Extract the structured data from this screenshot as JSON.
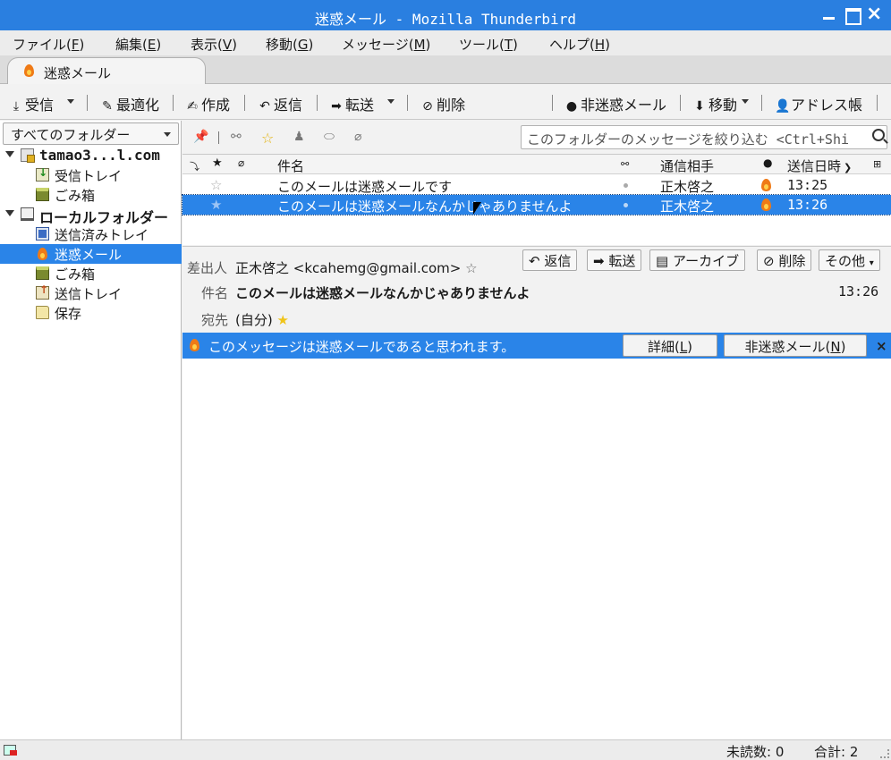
{
  "window": {
    "title": "迷惑メール - Mozilla Thunderbird"
  },
  "menubar": {
    "items": [
      {
        "label": "ファイル(",
        "key": "F",
        "end": ")"
      },
      {
        "label": "編集(",
        "key": "E",
        "end": ")"
      },
      {
        "label": "表示(",
        "key": "V",
        "end": ")"
      },
      {
        "label": "移動(",
        "key": "G",
        "end": ")"
      },
      {
        "label": "メッセージ(",
        "key": "M",
        "end": ")"
      },
      {
        "label": "ツール(",
        "key": "T",
        "end": ")"
      },
      {
        "label": "ヘルプ(",
        "key": "H",
        "end": ")"
      }
    ]
  },
  "tabs": [
    {
      "label": "迷惑メール",
      "icon": "flame-icon"
    }
  ],
  "toolbar": {
    "get_mail": "受信",
    "optimize": "最適化",
    "compose": "作成",
    "reply": "返信",
    "forward": "転送",
    "delete": "削除",
    "not_junk": "非迷惑メール",
    "move": "移動",
    "address_book": "アドレス帳"
  },
  "folderpane": {
    "selector": "すべてのフォルダー",
    "folders": [
      {
        "label": "tamao3...l.com",
        "type": "account"
      },
      {
        "label": "受信トレイ",
        "type": "inbox"
      },
      {
        "label": "ごみ箱",
        "type": "trash"
      },
      {
        "label": "ローカルフォルダー",
        "type": "local-account"
      },
      {
        "label": "送信済みトレイ",
        "type": "sent"
      },
      {
        "label": "迷惑メール",
        "type": "junk",
        "selected": true
      },
      {
        "label": "ごみ箱",
        "type": "trash"
      },
      {
        "label": "送信トレイ",
        "type": "outbox"
      },
      {
        "label": "保存",
        "type": "folder"
      }
    ]
  },
  "quickfilter": {
    "placeholder": "このフォルダーのメッセージを絞り込む <Ctrl+Shi"
  },
  "thread": {
    "columns": {
      "subject": "件名",
      "correspondent": "通信相手",
      "date": "送信日時"
    },
    "rows": [
      {
        "subject": "このメールは迷惑メールです",
        "correspondent": "正木啓之",
        "date": "13:25",
        "selected": false
      },
      {
        "subject": "このメールは迷惑メールなんかじゃありませんよ",
        "correspondent": "正木啓之",
        "date": "13:26",
        "selected": true
      }
    ]
  },
  "message": {
    "buttons": {
      "reply": "返信",
      "forward": "転送",
      "archive": "アーカイブ",
      "delete": "削除",
      "other": "その他"
    },
    "from_label": "差出人",
    "from_value": "正木啓之 <kcahemg@gmail.com>",
    "subject_label": "件名",
    "subject_value": "このメールは迷惑メールなんかじゃありませんよ",
    "time": "13:26",
    "to_label": "宛先",
    "to_value": "(自分)"
  },
  "junkbar": {
    "message": "このメッセージは迷惑メールであると思われます。",
    "details_label": "詳細(",
    "details_key": "L",
    "details_end": ")",
    "notjunk_label": "非迷惑メール(",
    "notjunk_key": "N",
    "notjunk_end": ")"
  },
  "statusbar": {
    "unread": "未読数: 0",
    "total": "合計: 2"
  },
  "colors": {
    "accent": "#2a84e8",
    "titlebar": "#2a7fe0",
    "flame": "#ef7a16",
    "star": "#f0c419"
  }
}
